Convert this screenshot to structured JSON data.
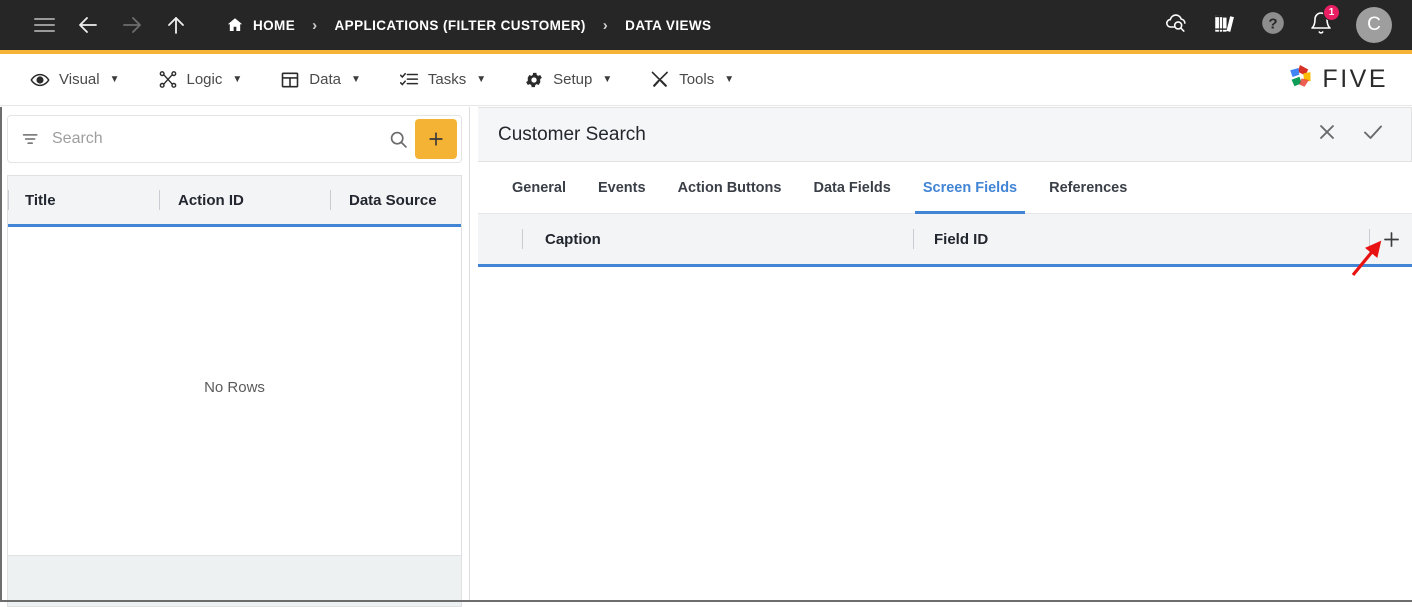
{
  "topbar": {
    "nav": {
      "menu_icon": "hamburger-icon",
      "back_icon": "arrow-left-icon",
      "forward_icon": "arrow-right-icon",
      "up_icon": "arrow-up-icon"
    },
    "breadcrumb": [
      {
        "label": "HOME",
        "icon": "home-icon"
      },
      {
        "label": "APPLICATIONS (FILTER CUSTOMER)",
        "icon": ""
      },
      {
        "label": "DATA VIEWS",
        "icon": ""
      }
    ],
    "separator": "›",
    "right_icons": [
      {
        "name": "cloud-search-icon",
        "label": ""
      },
      {
        "name": "library-books-icon",
        "label": ""
      },
      {
        "name": "help-icon",
        "label": ""
      },
      {
        "name": "notifications-bell-icon",
        "label": ""
      }
    ],
    "notification_count": "1",
    "avatar_initial": "C",
    "accent_color": "#f5b335",
    "background_color": "#262626"
  },
  "menubar": {
    "items": [
      {
        "label": "Visual",
        "icon": "eye-icon",
        "caret": "▼"
      },
      {
        "label": "Logic",
        "icon": "logic-nodes-icon",
        "caret": "▼"
      },
      {
        "label": "Data",
        "icon": "table-grid-icon",
        "caret": "▼"
      },
      {
        "label": "Tasks",
        "icon": "checklist-icon",
        "caret": "▼"
      },
      {
        "label": "Setup",
        "icon": "gear-icon",
        "caret": "▼"
      },
      {
        "label": "Tools",
        "icon": "tools-icon",
        "caret": "▼"
      }
    ],
    "brand": {
      "name": "FIVE",
      "logo_icon": "five-pinwheel-logo"
    }
  },
  "left_panel": {
    "search": {
      "placeholder": "Search",
      "value": "",
      "filter_icon": "filter-icon",
      "search_icon": "search-icon",
      "add_button_icon": "plus-icon",
      "add_button_color": "#f5b335"
    },
    "grid": {
      "columns": [
        "Title",
        "Action ID",
        "Data Source"
      ],
      "rows": [],
      "empty_message": "No Rows",
      "header_accent": "#4285d4"
    }
  },
  "right_panel": {
    "header": {
      "title": "Customer Search",
      "close_icon": "close-icon",
      "confirm_icon": "check-icon"
    },
    "tabs": [
      {
        "label": "General",
        "active": false
      },
      {
        "label": "Events",
        "active": false
      },
      {
        "label": "Action Buttons",
        "active": false
      },
      {
        "label": "Data Fields",
        "active": false
      },
      {
        "label": "Screen Fields",
        "active": true
      },
      {
        "label": "References",
        "active": false
      }
    ],
    "active_tab_color": "#4285d4",
    "grid": {
      "columns": [
        "Caption",
        "Field ID"
      ],
      "rows": [],
      "add_row_icon": "plus-icon",
      "header_accent": "#4285d4"
    }
  },
  "annotation": {
    "arrow_color": "#e81212",
    "points_to": "add-screen-field-button"
  }
}
